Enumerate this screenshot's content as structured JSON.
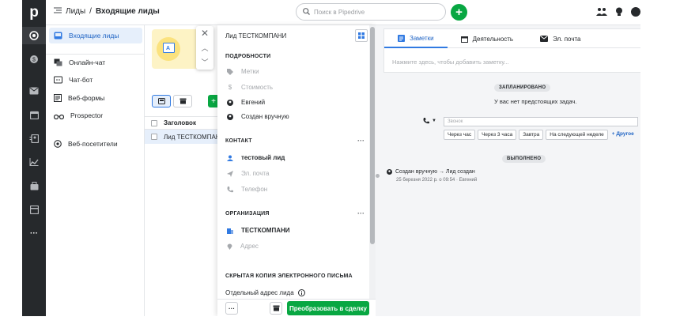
{
  "app": {
    "logo": "p"
  },
  "header": {
    "breadcrumb_root": "Лиды",
    "breadcrumb_sep": "/",
    "breadcrumb_current": "Входящие лиды",
    "search_placeholder": "Поиск в Pipedrive",
    "add_label": "+"
  },
  "subnav": {
    "items": [
      {
        "label": "Входящие лиды",
        "icon": "inbox-icon",
        "active": true
      },
      {
        "label": "Онлайн-чат",
        "icon": "chat-icon"
      },
      {
        "label": "Чат-бот",
        "icon": "chatbot-icon"
      },
      {
        "label": "Веб-формы",
        "icon": "form-icon"
      },
      {
        "label": "Prospector",
        "icon": "binoculars-icon"
      },
      {
        "label": "Веб-посетители",
        "icon": "visitors-icon"
      }
    ]
  },
  "list": {
    "column_title": "Заголовок",
    "row_title": "Лид ТЕСТКОМПАНИ"
  },
  "detail": {
    "title": "Лид ТЕСТКОМПАНИ",
    "details_header": "ПОДРОБНОСТИ",
    "labels": "Метки",
    "value": "Стоимость",
    "owner": "Евгений",
    "source": "Создан вручную",
    "contact_header": "КОНТАКТ",
    "contact_name": "тестовый лид",
    "email": "Эл. почта",
    "phone": "Телефон",
    "org_header": "ОРГАНИЗАЦИЯ",
    "org_name": "ТЕСТКОМПАНИ",
    "address": "Адрес",
    "bcc_header": "СКРЫТАЯ КОПИЯ ЭЛЕКТРОННОГО ПИСЬМА",
    "bcc_label": "Отдельный адрес лида",
    "more": "···",
    "convert_label": "Преобразовать в сделку"
  },
  "right": {
    "tabs": [
      {
        "label": "Заметки",
        "active": true
      },
      {
        "label": "Деятельность"
      },
      {
        "label": "Эл. почта"
      }
    ],
    "note_placeholder": "Нажмите здесь, чтобы добавить заметку...",
    "planned_label": "ЗАПЛАНИРОВАНО",
    "no_tasks": "У вас нет предстоящих задач.",
    "task_placeholder": "Звонок",
    "quick_buttons": [
      "Через час",
      "Через 3 часа",
      "Завтра",
      "На следующей неделе"
    ],
    "quick_more": "+ Другое",
    "done_label": "ВЫПОЛНЕНО",
    "done_event": "Создан вручную → Лид создан",
    "done_meta": "25 березня 2022 р. о 09:54 · Евгений"
  },
  "colors": {
    "accent": "#317ae2",
    "green": "#08a742",
    "rail": "#26292c"
  }
}
